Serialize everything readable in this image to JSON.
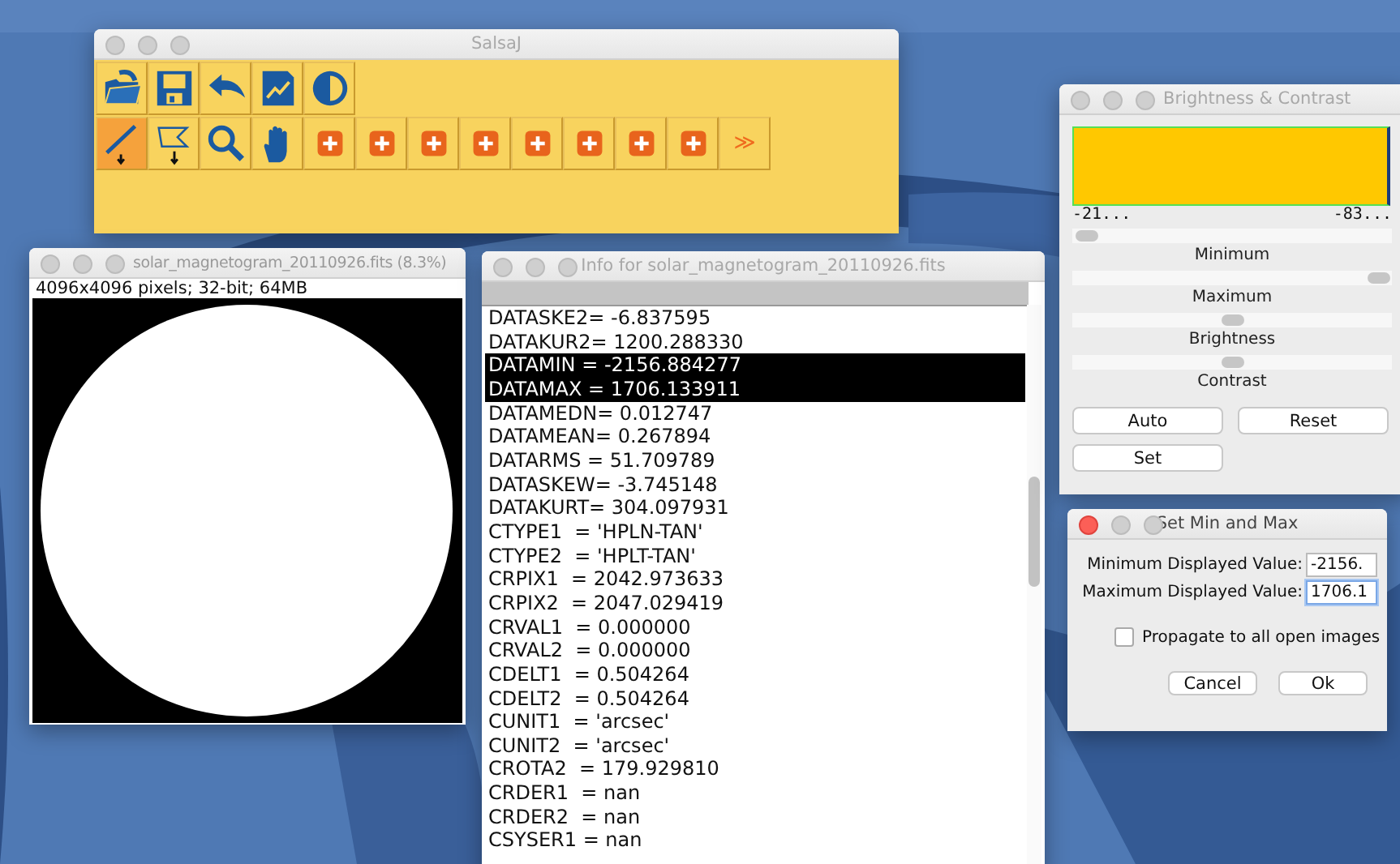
{
  "toolbar_window": {
    "title": "SalsaJ",
    "active": false,
    "row1": [
      {
        "kind": "open",
        "selected": false
      },
      {
        "kind": "save",
        "selected": false
      },
      {
        "kind": "undo",
        "selected": false
      },
      {
        "kind": "chart",
        "selected": false
      },
      {
        "kind": "contrast",
        "selected": false
      }
    ],
    "row2": [
      {
        "kind": "line",
        "selected": true
      },
      {
        "kind": "polygon",
        "selected": false
      },
      {
        "kind": "zoom",
        "selected": false
      },
      {
        "kind": "hand",
        "selected": false
      },
      {
        "kind": "plus",
        "selected": false
      },
      {
        "kind": "plus",
        "selected": false
      },
      {
        "kind": "plus",
        "selected": false
      },
      {
        "kind": "plus",
        "selected": false
      },
      {
        "kind": "plus",
        "selected": false
      },
      {
        "kind": "plus",
        "selected": false
      },
      {
        "kind": "plus",
        "selected": false
      },
      {
        "kind": "plus",
        "selected": false
      }
    ],
    "more": "≫"
  },
  "image_window": {
    "title": "solar_magnetogram_20110926.fits (8.3%)",
    "active": false,
    "info": "4096x4096 pixels; 32-bit; 64MB"
  },
  "info_window": {
    "title": "Info for solar_magnetogram_20110926.fits",
    "active": false,
    "lines": [
      {
        "text": "DATASKE2= -6.837595",
        "selected": false
      },
      {
        "text": "DATAKUR2= 1200.288330",
        "selected": false
      },
      {
        "text": "DATAMIN = -2156.884277",
        "selected": true
      },
      {
        "text": "DATAMAX = 1706.133911",
        "selected": true
      },
      {
        "text": "DATAMEDN= 0.012747",
        "selected": false
      },
      {
        "text": "DATAMEAN= 0.267894",
        "selected": false
      },
      {
        "text": "DATARMS = 51.709789",
        "selected": false
      },
      {
        "text": "DATASKEW= -3.745148",
        "selected": false
      },
      {
        "text": "DATAKURT= 304.097931",
        "selected": false
      },
      {
        "text": "CTYPE1  = 'HPLN-TAN'",
        "selected": false
      },
      {
        "text": "CTYPE2  = 'HPLT-TAN'",
        "selected": false
      },
      {
        "text": "CRPIX1  = 2042.973633",
        "selected": false
      },
      {
        "text": "CRPIX2  = 2047.029419",
        "selected": false
      },
      {
        "text": "CRVAL1  = 0.000000",
        "selected": false
      },
      {
        "text": "CRVAL2  = 0.000000",
        "selected": false
      },
      {
        "text": "CDELT1  = 0.504264",
        "selected": false
      },
      {
        "text": "CDELT2  = 0.504264",
        "selected": false
      },
      {
        "text": "CUNIT1  = 'arcsec'",
        "selected": false
      },
      {
        "text": "CUNIT2  = 'arcsec'",
        "selected": false
      },
      {
        "text": "CROTA2  = 179.929810",
        "selected": false
      },
      {
        "text": "CRDER1  = nan",
        "selected": false
      },
      {
        "text": "CRDER2  = nan",
        "selected": false
      },
      {
        "text": "CSYSER1 = nan",
        "selected": false
      }
    ]
  },
  "bc_window": {
    "title": "Brightness & Contrast",
    "active": false,
    "hist_min": "-21...",
    "hist_max": "-83...",
    "sliders": [
      {
        "label": "Minimum",
        "level": 0
      },
      {
        "label": "Maximum",
        "level": 1
      },
      {
        "label": "Brightness",
        "level": 0.5
      },
      {
        "label": "Contrast",
        "level": 0.5
      }
    ],
    "buttons": [
      "Auto",
      "Reset",
      "Set"
    ]
  },
  "minmax_dialog": {
    "title": "Set Min and Max",
    "active": true,
    "fields": [
      {
        "label": "Minimum Displayed Value:",
        "value": "-2156.",
        "focused": false
      },
      {
        "label": "Maximum Displayed Value:",
        "value": "1706.1",
        "focused": true
      }
    ],
    "checkbox": {
      "label": "Propagate to all open images",
      "checked": false
    },
    "buttons": [
      "Cancel",
      "Ok"
    ]
  }
}
